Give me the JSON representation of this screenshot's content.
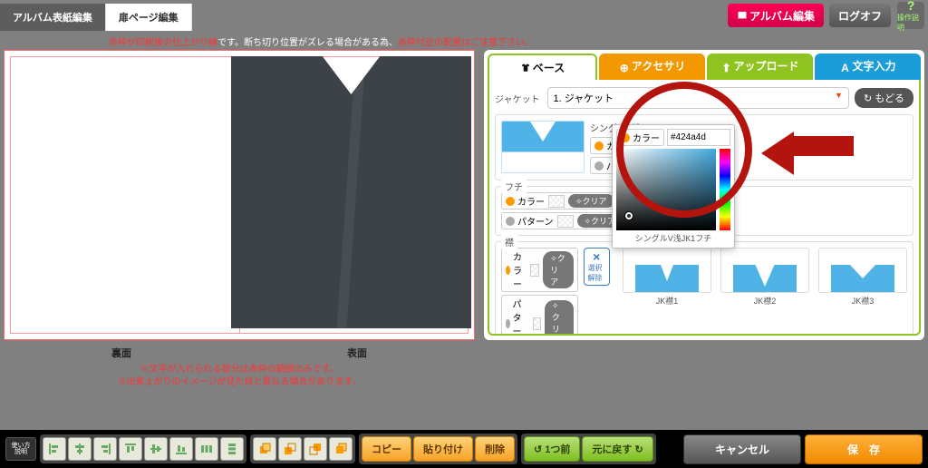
{
  "tabs": {
    "cover": "アルバム表紙編集",
    "page": "扉ページ編集"
  },
  "top": {
    "album": "アルバム編集",
    "logoff": "ログオフ",
    "help": "操作説明"
  },
  "warn": {
    "red1": "赤枠が印刷後の仕上がり線",
    "white": "です。断ち切り位置がズレる場合がある為、",
    "red2": "赤枠付近の配置はご注意下さい。"
  },
  "pageLabels": {
    "back": "裏面",
    "front": "表面"
  },
  "footNote": {
    "l1": "※文字が入れられる部分は赤枠の範囲のみです。",
    "l2": "※出来上がりのイメージが見た目と異なる場合があります。"
  },
  "ptabs": {
    "base": "ベース",
    "acc": "アクセサリ",
    "upload": "アップロード",
    "text": "文字入力"
  },
  "panel": {
    "jacketLabel": "ジャケット",
    "select": "1. ジャケット",
    "back": "もどる",
    "itemName": "シングルV浅JK1ベ",
    "color": "カラー",
    "pattern": "パターン",
    "clear": "クリア",
    "hex": "#424a4d",
    "popLabel": "シングルV浅JK1フチ",
    "fuchi": "フチ",
    "eri": "襟",
    "desel": "選択解除",
    "collars": [
      "JK襟1",
      "JK襟2",
      "JK襟3"
    ]
  },
  "bottom": {
    "howto1": "使い方",
    "howto2": "説明",
    "copy": "コピー",
    "paste": "貼り付け",
    "delete": "削除",
    "undo": "1つ前",
    "redo": "元に戻す",
    "cancel": "キャンセル",
    "save": "保　存"
  }
}
